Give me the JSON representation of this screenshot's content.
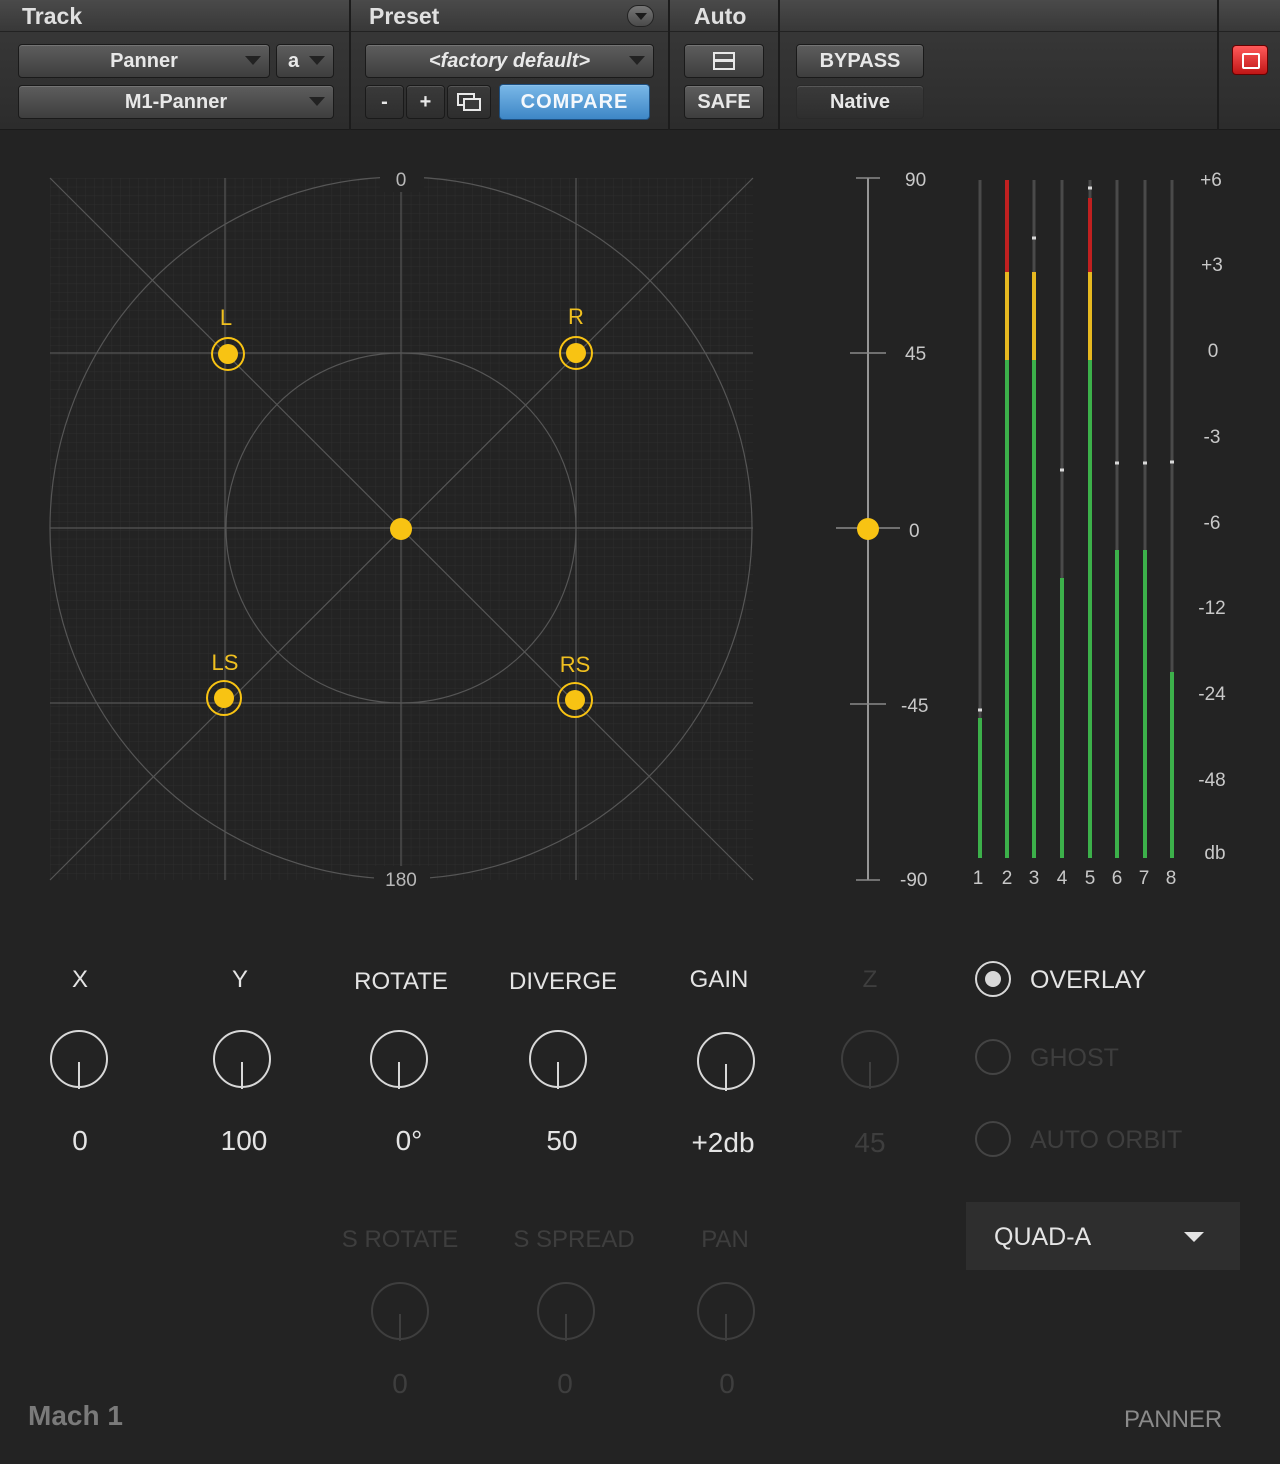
{
  "header": {
    "track_label": "Track",
    "preset_label": "Preset",
    "auto_label": "Auto",
    "track_select": "Panner",
    "track_channel": "a",
    "plugin_select": "M1-Panner",
    "preset_select": "<factory default>",
    "minus_label": "-",
    "plus_label": "+",
    "compare_label": "COMPARE",
    "safe_label": "SAFE",
    "bypass_label": "BYPASS",
    "native_label": "Native"
  },
  "panner": {
    "top_label": "0",
    "bottom_label": "180",
    "speakers": [
      {
        "label": "L"
      },
      {
        "label": "R"
      },
      {
        "label": "LS"
      },
      {
        "label": "RS"
      }
    ]
  },
  "elevation": {
    "ticks": [
      "90",
      "45",
      "0",
      "-45",
      "-90"
    ],
    "value": 0
  },
  "meters": {
    "db_labels": [
      "+6",
      "+3",
      "0",
      "-3",
      "-6",
      "-12",
      "-24",
      "-48"
    ],
    "unit": "db",
    "channels": [
      "1",
      "2",
      "3",
      "4",
      "5",
      "6",
      "7",
      "8"
    ]
  },
  "knobs": [
    {
      "label": "X",
      "value": "0"
    },
    {
      "label": "Y",
      "value": "100"
    },
    {
      "label": "ROTATE",
      "value": "0°"
    },
    {
      "label": "DIVERGE",
      "value": "50"
    },
    {
      "label": "GAIN",
      "value": "+2db"
    },
    {
      "label": "Z",
      "value": "45"
    }
  ],
  "stereo_knobs": [
    {
      "label": "S ROTATE",
      "value": "0"
    },
    {
      "label": "S SPREAD",
      "value": "0"
    },
    {
      "label": "PAN",
      "value": "0"
    }
  ],
  "options": {
    "overlay": "OVERLAY",
    "ghost": "GHOST",
    "auto_orbit": "AUTO ORBIT"
  },
  "mode": "QUAD-A",
  "brand": "Mach 1",
  "module": "PANNER",
  "colors": {
    "accent": "#f8c313",
    "background": "#232323",
    "compare_blue": "#4a92d0",
    "meter_green": "#3cb04a",
    "meter_yellow": "#e6b820",
    "meter_red": "#c02020"
  }
}
